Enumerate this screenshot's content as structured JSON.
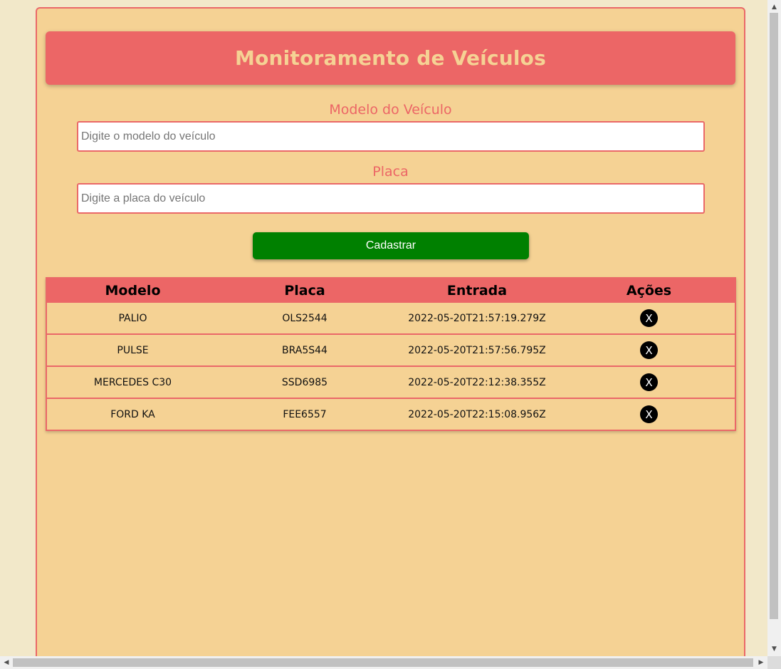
{
  "header": {
    "title": "Monitoramento de Veículos"
  },
  "form": {
    "model_label": "Modelo do Veículo",
    "model_placeholder": "Digite o modelo do veículo",
    "model_value": "",
    "plate_label": "Placa",
    "plate_placeholder": "Digite a placa do veículo",
    "plate_value": "",
    "submit_label": "Cadastrar"
  },
  "table": {
    "headers": [
      "Modelo",
      "Placa",
      "Entrada",
      "Ações"
    ],
    "rows": [
      {
        "modelo": "PALIO",
        "placa": "OLS2544",
        "entrada": "2022-05-20T21:57:19.279Z",
        "acao": "X"
      },
      {
        "modelo": "PULSE",
        "placa": "BRA5S44",
        "entrada": "2022-05-20T21:57:56.795Z",
        "acao": "X"
      },
      {
        "modelo": "MERCEDES C30",
        "placa": "SSD6985",
        "entrada": "2022-05-20T22:12:38.355Z",
        "acao": "X"
      },
      {
        "modelo": "FORD KA",
        "placa": "FEE6557",
        "entrada": "2022-05-20T22:15:08.956Z",
        "acao": "X"
      }
    ]
  },
  "colors": {
    "page_bg": "#f2e8c9",
    "panel_bg": "#f5d294",
    "accent": "#ec6666",
    "button_bg": "#008000"
  },
  "icons": {
    "delete": "close-icon",
    "scroll_up": "arrow-up-icon",
    "scroll_down": "arrow-down-icon",
    "scroll_left": "arrow-left-icon",
    "scroll_right": "arrow-right-icon"
  }
}
